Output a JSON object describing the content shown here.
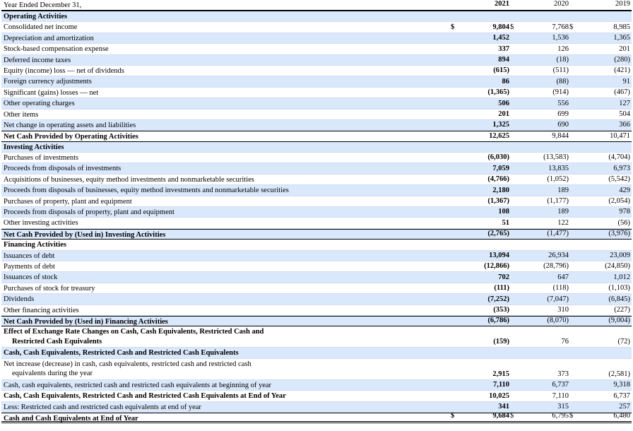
{
  "header": {
    "label": "Year Ended December 31,",
    "years": [
      "2021",
      "2020",
      "2019"
    ]
  },
  "currency_symbol": "$",
  "rows": [
    {
      "label": "Operating Activities",
      "style": "section",
      "values": [
        "",
        "",
        ""
      ]
    },
    {
      "label": "Consolidated net income",
      "values": [
        "9,804",
        "7,768",
        "8,985"
      ],
      "dollar": true
    },
    {
      "label": "Depreciation and amortization",
      "values": [
        "1,452",
        "1,536",
        "1,365"
      ]
    },
    {
      "label": "Stock-based compensation expense",
      "values": [
        "337",
        "126",
        "201"
      ]
    },
    {
      "label": "Deferred income taxes",
      "values": [
        "894",
        "(18)",
        "(280)"
      ]
    },
    {
      "label": "Equity (income) loss — net of dividends",
      "values": [
        "(615)",
        "(511)",
        "(421)"
      ]
    },
    {
      "label": "Foreign currency adjustments",
      "values": [
        "86",
        "(88)",
        "91"
      ]
    },
    {
      "label": "Significant (gains) losses — net",
      "values": [
        "(1,365)",
        "(914)",
        "(467)"
      ]
    },
    {
      "label": "Other operating charges",
      "values": [
        "506",
        "556",
        "127"
      ]
    },
    {
      "label": "Other items",
      "values": [
        "201",
        "699",
        "504"
      ]
    },
    {
      "label": "Net change in operating assets and liabilities",
      "values": [
        "1,325",
        "690",
        "366"
      ]
    },
    {
      "label": "Net Cash Provided by Operating Activities",
      "style": "total",
      "values": [
        "12,625",
        "9,844",
        "10,471"
      ]
    },
    {
      "label": "Investing Activities",
      "style": "section",
      "values": [
        "",
        "",
        ""
      ]
    },
    {
      "label": "Purchases of investments",
      "values": [
        "(6,030)",
        "(13,583)",
        "(4,704)"
      ]
    },
    {
      "label": "Proceeds from disposals of investments",
      "values": [
        "7,059",
        "13,835",
        "6,973"
      ]
    },
    {
      "label": "Acquisitions of businesses, equity method investments and nonmarketable securities",
      "values": [
        "(4,766)",
        "(1,052)",
        "(5,542)"
      ]
    },
    {
      "label": "Proceeds from disposals of businesses, equity method investments and nonmarketable securities",
      "values": [
        "2,180",
        "189",
        "429"
      ]
    },
    {
      "label": "Purchases of property, plant and equipment",
      "values": [
        "(1,367)",
        "(1,177)",
        "(2,054)"
      ]
    },
    {
      "label": "Proceeds from disposals of property, plant and equipment",
      "values": [
        "108",
        "189",
        "978"
      ]
    },
    {
      "label": "Other investing activities",
      "values": [
        "51",
        "122",
        "(56)"
      ]
    },
    {
      "label": "Net Cash Provided by (Used in) Investing Activities",
      "style": "total",
      "values": [
        "(2,765)",
        "(1,477)",
        "(3,976)"
      ]
    },
    {
      "label": "Financing Activities",
      "style": "section",
      "values": [
        "",
        "",
        ""
      ]
    },
    {
      "label": "Issuances of debt",
      "values": [
        "13,094",
        "26,934",
        "23,009"
      ]
    },
    {
      "label": "Payments of debt",
      "values": [
        "(12,866)",
        "(28,796)",
        "(24,850)"
      ]
    },
    {
      "label": "Issuances of stock",
      "values": [
        "702",
        "647",
        "1,012"
      ]
    },
    {
      "label": "Purchases of stock for treasury",
      "values": [
        "(111)",
        "(118)",
        "(1,103)"
      ]
    },
    {
      "label": "Dividends",
      "values": [
        "(7,252)",
        "(7,047)",
        "(6,845)"
      ]
    },
    {
      "label": "Other financing activities",
      "values": [
        "(353)",
        "310",
        "(227)"
      ]
    },
    {
      "label": "Net Cash Provided by (Used in) Financing Activities",
      "style": "total",
      "values": [
        "(6,786)",
        "(8,070)",
        "(9,004)"
      ]
    },
    {
      "label": "Effect of Exchange Rate Changes on Cash, Cash Equivalents, Restricted Cash and",
      "label2": "Restricted Cash Equivalents",
      "style": "tallbold",
      "values": [
        "(159)",
        "76",
        "(72)"
      ]
    },
    {
      "label": "Cash, Cash Equivalents, Restricted Cash and Restricted Cash Equivalents",
      "style": "section",
      "values": [
        "",
        "",
        ""
      ]
    },
    {
      "label": "Net increase (decrease) in cash, cash equivalents, restricted cash and restricted cash",
      "label2": "equivalents during the year",
      "style": "tall",
      "values": [
        "2,915",
        "373",
        "(2,581)"
      ]
    },
    {
      "label": "Cash, cash equivalents, restricted cash and restricted cash equivalents at beginning of year",
      "values": [
        "7,110",
        "6,737",
        "9,318"
      ]
    },
    {
      "label": "Cash, Cash Equivalents, Restricted Cash and Restricted Cash Equivalents at End of Year",
      "style": "bold",
      "values": [
        "10,025",
        "7,110",
        "6,737"
      ]
    },
    {
      "label": "Less: Restricted cash and restricted cash equivalents at end of year",
      "values": [
        "341",
        "315",
        "257"
      ]
    },
    {
      "label": "Cash and Cash Equivalents at End of Year",
      "style": "final",
      "values": [
        "9,684",
        "6,795",
        "6,480"
      ],
      "dollar": true
    }
  ]
}
